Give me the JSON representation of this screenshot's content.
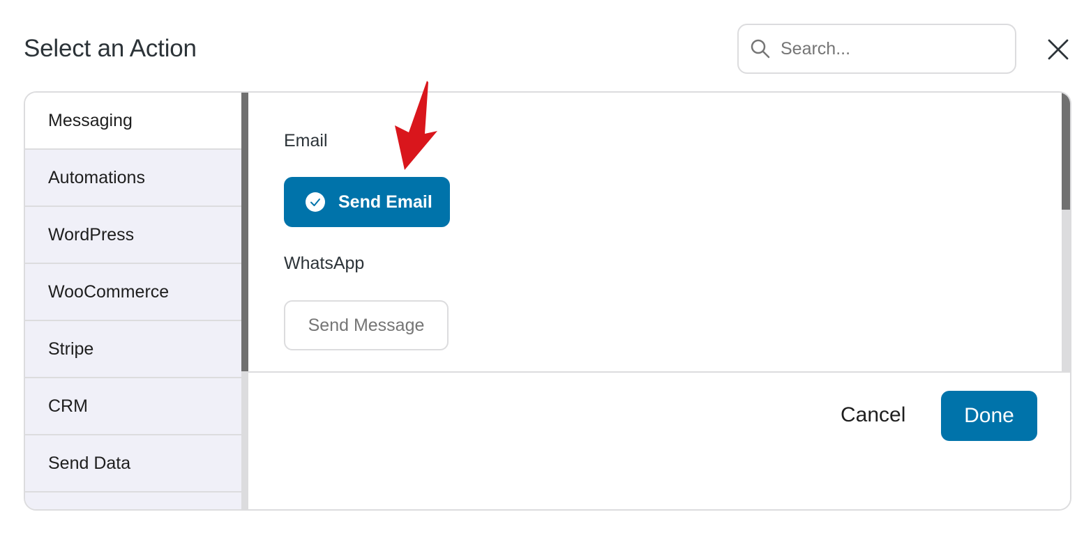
{
  "header": {
    "title": "Select an Action",
    "search_placeholder": "Search...",
    "search_value": ""
  },
  "sidebar": {
    "items": [
      {
        "label": "Messaging",
        "active": true
      },
      {
        "label": "Automations",
        "active": false
      },
      {
        "label": "WordPress",
        "active": false
      },
      {
        "label": "WooCommerce",
        "active": false
      },
      {
        "label": "Stripe",
        "active": false
      },
      {
        "label": "CRM",
        "active": false
      },
      {
        "label": "Send Data",
        "active": false
      }
    ]
  },
  "content": {
    "groups": [
      {
        "label": "Email",
        "actions": [
          {
            "label": "Send Email",
            "selected": true
          }
        ]
      },
      {
        "label": "WhatsApp",
        "actions": [
          {
            "label": "Send Message",
            "selected": false
          }
        ]
      }
    ]
  },
  "footer": {
    "cancel_label": "Cancel",
    "done_label": "Done"
  },
  "colors": {
    "accent": "#0073aa",
    "annotation": "#d9161c",
    "border": "#dcdcde",
    "sidebar_bg": "#f0f0f8"
  },
  "icons": {
    "search": "search-icon",
    "close": "close-icon",
    "check": "check-circle-icon",
    "annotation": "red-arrow-annotation"
  }
}
